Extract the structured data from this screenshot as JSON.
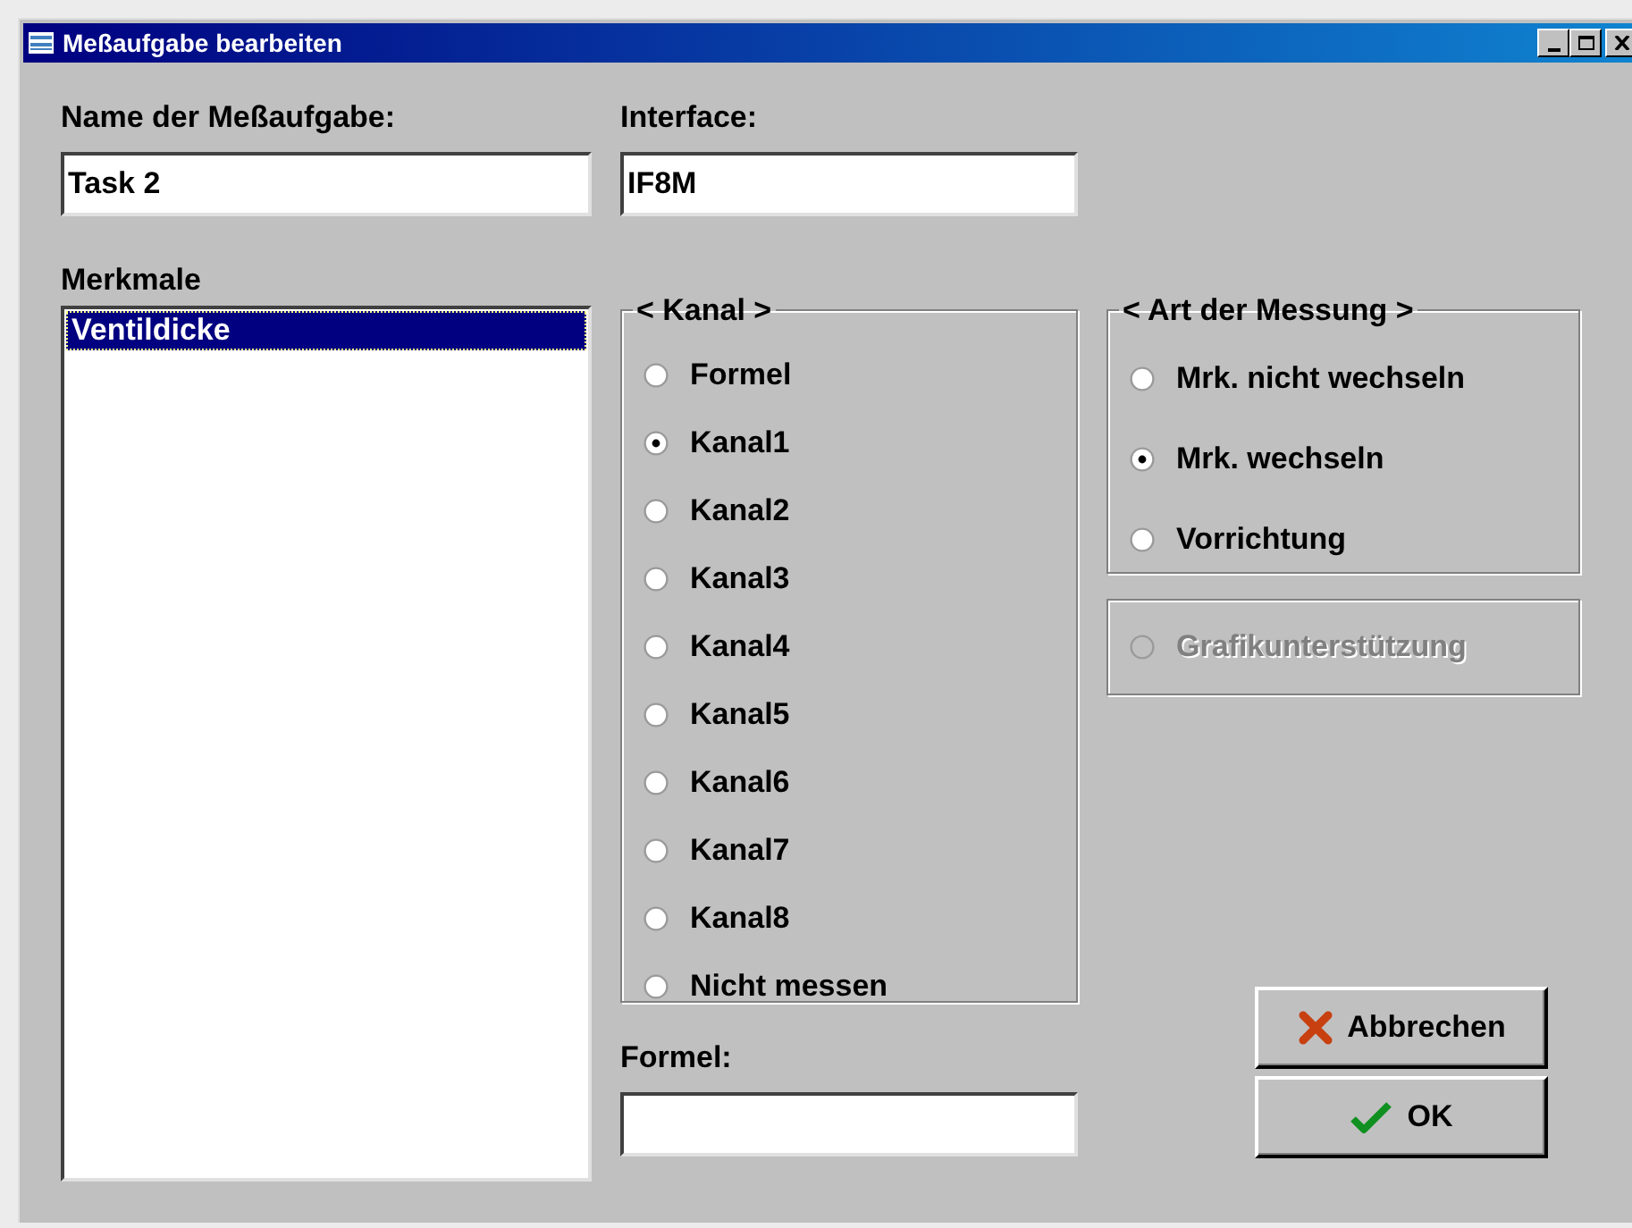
{
  "window": {
    "title": "Meßaufgabe bearbeiten"
  },
  "name_field": {
    "label": "Name der Meßaufgabe:",
    "value": "Task 2"
  },
  "interface_field": {
    "label": "Interface:",
    "value": "IF8M"
  },
  "merkmale": {
    "label": "Merkmale",
    "items": [
      {
        "label": "Ventildicke",
        "selected": true
      }
    ]
  },
  "kanal": {
    "title": "< Kanal >",
    "options": [
      {
        "label": "Formel",
        "selected": false
      },
      {
        "label": "Kanal1",
        "selected": true
      },
      {
        "label": "Kanal2",
        "selected": false
      },
      {
        "label": "Kanal3",
        "selected": false
      },
      {
        "label": "Kanal4",
        "selected": false
      },
      {
        "label": "Kanal5",
        "selected": false
      },
      {
        "label": "Kanal6",
        "selected": false
      },
      {
        "label": "Kanal7",
        "selected": false
      },
      {
        "label": "Kanal8",
        "selected": false
      },
      {
        "label": "Nicht messen",
        "selected": false
      }
    ]
  },
  "art": {
    "title": "< Art der Messung >",
    "options": [
      {
        "label": "Mrk. nicht wechseln",
        "selected": false
      },
      {
        "label": "Mrk. wechseln",
        "selected": true
      },
      {
        "label": "Vorrichtung",
        "selected": false
      }
    ]
  },
  "grafik": {
    "label": "Grafikunterstützung",
    "selected": false,
    "disabled": true
  },
  "formel_field": {
    "label": "Formel:"
  },
  "buttons": [
    {
      "label": "Abbrechen",
      "kind": "cancel"
    },
    {
      "label": "OK",
      "kind": "ok"
    }
  ]
}
